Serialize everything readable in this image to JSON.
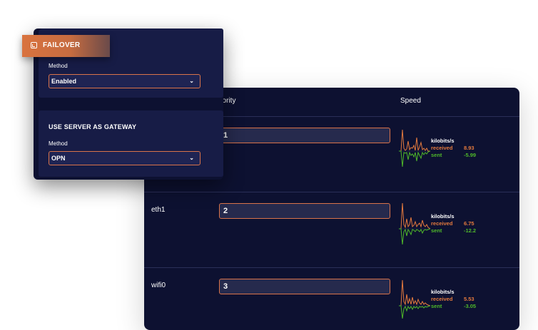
{
  "failover": {
    "tab_label": "FAILOVER",
    "icon": "failover-icon",
    "method_label": "Method",
    "method_value": "Enabled"
  },
  "gateway": {
    "title": "USE SERVER AS GATEWAY",
    "method_label": "Method",
    "method_value": "OPN"
  },
  "table": {
    "headers": {
      "priority": "riority",
      "speed": "Speed"
    },
    "rows": [
      {
        "name": "",
        "priority": "1",
        "unit": "kilobits/s",
        "received_label": "received",
        "received": "8.93",
        "sent_label": "sent",
        "sent": "-5.99"
      },
      {
        "name": "eth1",
        "priority": "2",
        "unit": "kilobits/s",
        "received_label": "received",
        "received": "6.75",
        "sent_label": "sent",
        "sent": "-12.2"
      },
      {
        "name": "wifi0",
        "priority": "3",
        "unit": "kilobits/s",
        "received_label": "received",
        "received": "5.53",
        "sent_label": "sent",
        "sent": "-3.05"
      }
    ]
  },
  "colors": {
    "panel_bg": "#0d1131",
    "card_bg": "#171c46",
    "accent": "#d9734a",
    "received": "#e47a3e",
    "sent": "#4fb82a"
  }
}
